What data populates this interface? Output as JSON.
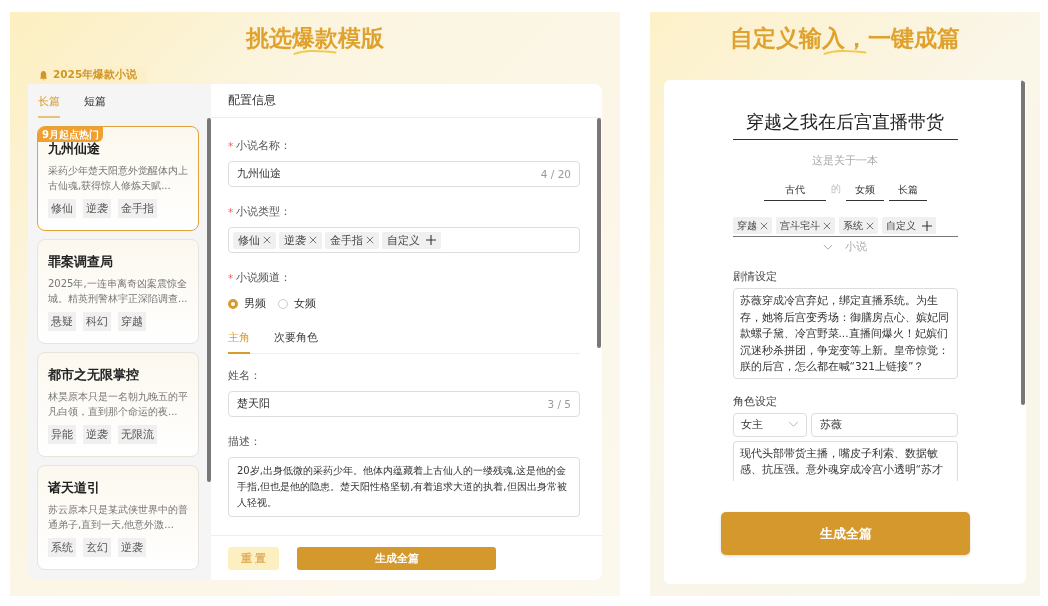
{
  "left_panel": {
    "title": "挑选爆款模版",
    "badge": "2025年爆款小说",
    "tabs": [
      {
        "label": "长篇",
        "selected": true
      },
      {
        "label": "短篇",
        "selected": false
      }
    ],
    "novels": [
      {
        "title": "九州仙途",
        "summary": "采药少年楚天阳意外觉醒体内上古仙魂,获得惊人修炼天赋...",
        "tags": [
          "修仙",
          "逆袭",
          "金手指"
        ],
        "selected": true,
        "ribbon": "9月起点热门"
      },
      {
        "title": "罪案调查局",
        "summary": "2025年,一连串离奇凶案震惊全城。精英刑警林宇正深陷调查...",
        "tags": [
          "悬疑",
          "科幻",
          "穿越"
        ],
        "selected": false
      },
      {
        "title": "都市之无限掌控",
        "summary": "林昊原本只是一名朝九晚五的平凡白领，直到那个命运的夜...",
        "tags": [
          "异能",
          "逆袭",
          "无限流"
        ],
        "selected": false
      },
      {
        "title": "诸天道引",
        "summary": "苏云原本只是某武侠世界中的普通弟子,直到一天,他意外激...",
        "tags": [
          "系统",
          "玄幻",
          "逆袭"
        ],
        "selected": false
      }
    ]
  },
  "form": {
    "header": "配置信息",
    "mark": "*",
    "name_field": {
      "label": "小说名称：",
      "value": "九州仙途",
      "counter": "4 / 20"
    },
    "type_field": {
      "label": "小说类型：",
      "tags": [
        "修仙",
        "逆袭",
        "金手指"
      ],
      "custom": "自定义"
    },
    "channel_field": {
      "label": "小说频道：",
      "options": [
        {
          "label": "男频",
          "selected": true
        },
        {
          "label": "女频",
          "selected": false
        }
      ]
    },
    "role_tabs": [
      {
        "label": "主角",
        "selected": true
      },
      {
        "label": "次要角色",
        "selected": false
      }
    ],
    "role_name": {
      "label": "姓名：",
      "value": "楚天阳",
      "counter": "3 / 5"
    },
    "role_desc": {
      "label": "描述：",
      "value": "20岁,出身低微的采药少年。他体内蕴藏着上古仙人的一缕残魂,这是他的金手指,但也是他的隐患。楚天阳性格坚韧,有着追求大道的执着,但因出身常被人轻视。"
    },
    "reset_button": "重 置",
    "generate_button": "生成全篇"
  },
  "right_panel": {
    "title": "自定义输入，一键成篇",
    "novel_title": "穿越之我在后宫直播带货",
    "intro": "这是关于一本",
    "era": "古代",
    "of": "的",
    "channel": "女频",
    "length": "长篇",
    "tags": [
      "穿越",
      "宫斗宅斗",
      "系统"
    ],
    "custom": "自定义",
    "suffix": "小说",
    "plot_label": "剧情设定",
    "plot": "苏薇穿成冷宫弃妃，绑定直播系统。为生存，她将后宫变秀场：御膳房点心、嫔妃同款螺子黛、冷宫野菜...直播间爆火！妃嫔们沉迷秒杀拼团，争宠变等上新。皇帝惊觉：朕的后宫，怎么都在喊“321上链接”？",
    "role_label": "角色设定",
    "role_type": "女主",
    "role_name": "苏薇",
    "role_desc": "现代头部带货主播，嘴皮子利索、数据敏感、抗压强。意外魂穿成冷宫小透明“苏才",
    "generate_button": "生成全篇"
  }
}
